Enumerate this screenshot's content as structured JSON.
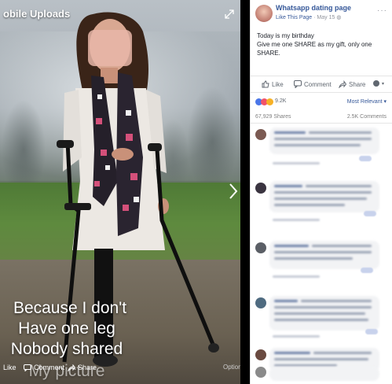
{
  "photo": {
    "title": "obile Uploads",
    "caption": [
      "Because I don't",
      "Have one leg",
      "Nobody shared",
      "My picture"
    ],
    "actions": {
      "like": "Like",
      "comment": "Comment",
      "share": "Share",
      "options": "Options"
    }
  },
  "post": {
    "page_name": "Whatsapp dating page",
    "like_page": "Like This Page",
    "date": "May 15",
    "text_line1": "Today is my birthday",
    "text_line2": "Give me one SHARE as my gift, only one SHARE.",
    "actions": {
      "like": "Like",
      "comment": "Comment",
      "share": "Share"
    },
    "reactions_count": "9.2K",
    "most_relevant": "Most Relevant ▾",
    "shares": "67,929 Shares",
    "comments_count": "2.5K Comments"
  },
  "colors": {
    "fb_blue": "#365899",
    "grey_text": "#90949c",
    "panel_bg": "#ffffff"
  }
}
